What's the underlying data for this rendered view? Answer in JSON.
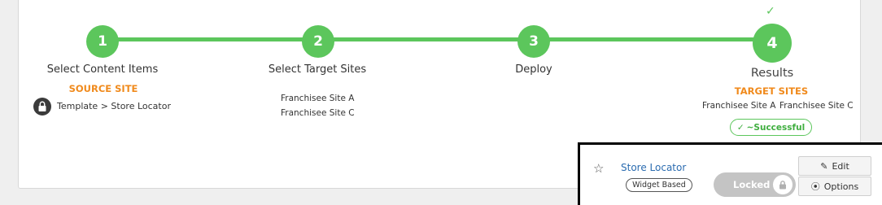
{
  "steps": [
    {
      "number": "1",
      "title": "Select Content Items",
      "section_label": "SOURCE SITE",
      "items": [
        "Template > Store Locator"
      ]
    },
    {
      "number": "2",
      "title": "Select Target Sites",
      "items": [
        "Franchisee Site A",
        "Franchisee Site C"
      ]
    },
    {
      "number": "3",
      "title": "Deploy"
    },
    {
      "number": "4",
      "title": "Results",
      "section_label": "TARGET SITES",
      "items": [
        "Franchisee Site A",
        "Franchisee Site C"
      ],
      "status": "~Successful"
    }
  ],
  "popup": {
    "item_name": "Store Locator",
    "badge": "Widget Based",
    "lock_label": "Locked",
    "edit_label": "Edit",
    "options_label": "Options"
  },
  "colors": {
    "accent_green": "#5cc65c",
    "label_orange": "#f08a1c",
    "link_blue": "#2b6cb0"
  },
  "icons": [
    "check-icon",
    "lock-icon",
    "star-icon",
    "pencil-icon",
    "target-icon"
  ]
}
